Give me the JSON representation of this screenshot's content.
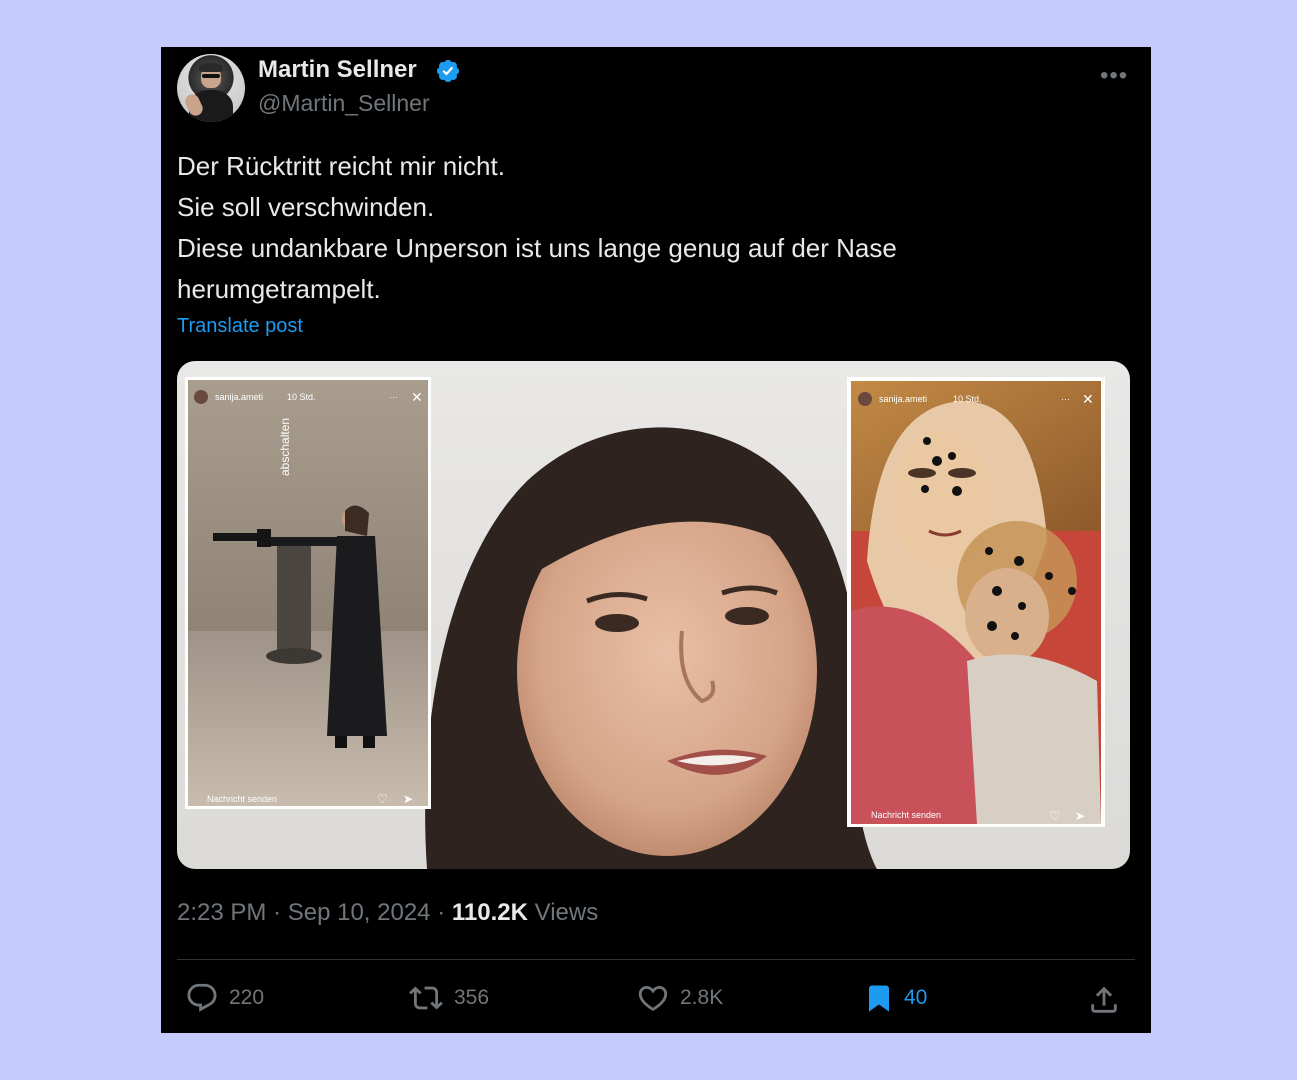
{
  "author": {
    "name": "Martin Sellner",
    "handle": "@Martin_Sellner",
    "verified": true,
    "avatar_icon": "profile-photo"
  },
  "post": {
    "lines": [
      "Der Rücktritt reicht mir nicht.",
      "Sie soll verschwinden.",
      "Diese undankbare Unperson ist uns lange genug auf der Nase",
      "herumgetrampelt."
    ],
    "translate_label": "Translate post"
  },
  "media": {
    "left_story": {
      "user": "sanija.ameti",
      "time": "10 Std.",
      "sticker": "abschalten",
      "message_placeholder": "Nachricht senden"
    },
    "right_story": {
      "user": "sanija.ameti",
      "time": "10 Std.",
      "message_placeholder": "Nachricht senden"
    }
  },
  "meta": {
    "time": "2:23 PM",
    "separator": "·",
    "date": "Sep 10, 2024",
    "views_count": "110.2K",
    "views_label": "Views"
  },
  "actions": {
    "replies": "220",
    "reposts": "356",
    "likes": "2.8K",
    "bookmarks": "40"
  },
  "colors": {
    "background": "#c5cbfd",
    "card": "#000000",
    "accent": "#1d9bf0",
    "muted": "#71767b",
    "text": "#e7e9ea"
  }
}
